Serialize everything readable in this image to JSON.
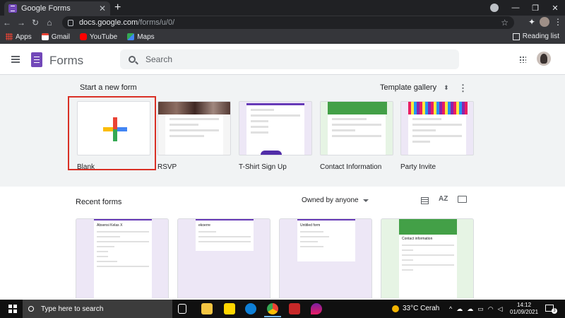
{
  "browser": {
    "tab_title": "Google Forms",
    "url_host": "docs.google.com",
    "url_path": "/forms/u/0/",
    "bookmarks": [
      {
        "label": "Apps",
        "color": "#ea4335"
      },
      {
        "label": "Gmail",
        "color": "#ea4335"
      },
      {
        "label": "YouTube",
        "color": "#ff0000"
      },
      {
        "label": "Maps",
        "color": "#34a853"
      }
    ],
    "reading_list": "Reading list"
  },
  "header": {
    "app_name": "Forms",
    "search_placeholder": "Search",
    "brand_color": "#7248b9"
  },
  "start": {
    "title": "Start a new form",
    "template_gallery": "Template gallery",
    "templates": [
      {
        "label": "Blank"
      },
      {
        "label": "RSVP"
      },
      {
        "label": "T-Shirt Sign Up"
      },
      {
        "label": "Contact Information"
      },
      {
        "label": "Party Invite"
      }
    ]
  },
  "recent": {
    "title": "Recent forms",
    "owner_filter": "Owned by anyone",
    "cards": [
      {
        "title": "Absensi Kelas X",
        "theme": "purple"
      },
      {
        "title": "ekoerre",
        "theme": "purple"
      },
      {
        "title": "Untitled form",
        "theme": "purple"
      },
      {
        "title": "Contact information",
        "theme": "green"
      }
    ]
  },
  "taskbar": {
    "search_placeholder": "Type here to search",
    "weather": "33°C  Cerah",
    "time": "14:12",
    "date": "01/09/2021",
    "notifications": "3"
  }
}
